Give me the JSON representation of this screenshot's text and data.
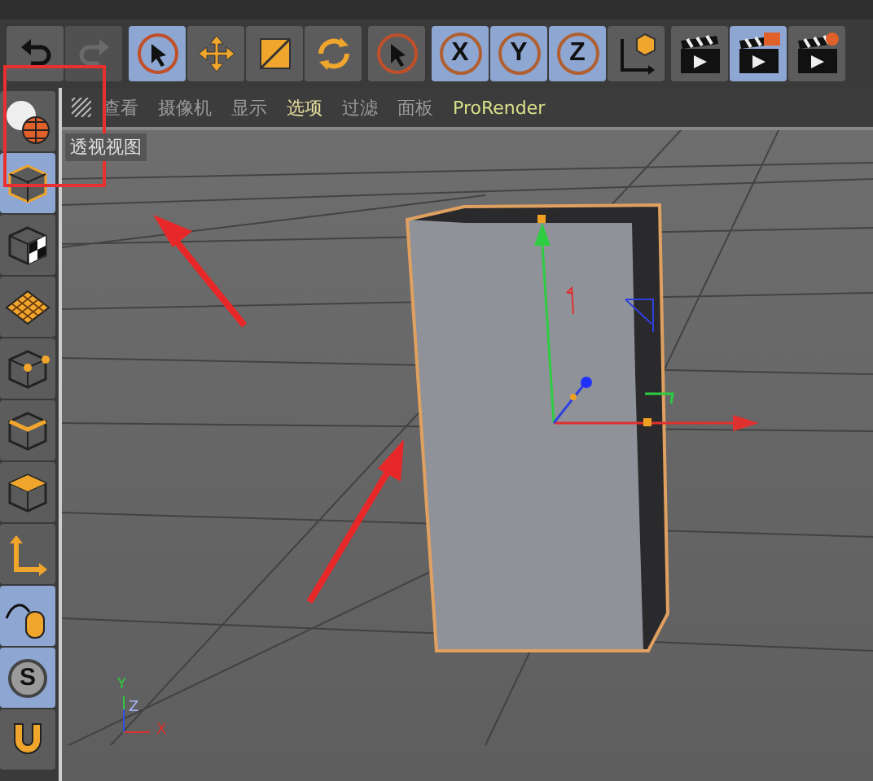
{
  "toolbar": [
    {
      "kind": "undo",
      "selected": false,
      "disabled": false
    },
    {
      "kind": "redo",
      "selected": false,
      "disabled": true
    },
    {
      "kind": "select",
      "selected": true,
      "disabled": false
    },
    {
      "kind": "move",
      "selected": false,
      "disabled": false
    },
    {
      "kind": "scale",
      "selected": false,
      "disabled": false
    },
    {
      "kind": "rotate",
      "selected": false,
      "disabled": false
    },
    {
      "kind": "select",
      "selected": false,
      "disabled": false
    },
    {
      "kind": "axis",
      "label": "X",
      "selected": true,
      "disabled": false
    },
    {
      "kind": "axis",
      "label": "Y",
      "selected": true,
      "disabled": false
    },
    {
      "kind": "axis",
      "label": "Z",
      "selected": true,
      "disabled": false
    },
    {
      "kind": "coords",
      "selected": false,
      "disabled": false
    },
    {
      "kind": "render",
      "selected": false,
      "disabled": false
    },
    {
      "kind": "render-settings",
      "selected": true,
      "disabled": false
    },
    {
      "kind": "render-gear",
      "selected": false,
      "disabled": false
    }
  ],
  "side_tools": [
    {
      "kind": "globe",
      "selected": false
    },
    {
      "kind": "cube",
      "selected": true
    },
    {
      "kind": "texture",
      "selected": false
    },
    {
      "kind": "plane",
      "selected": false
    },
    {
      "kind": "points",
      "selected": false
    },
    {
      "kind": "edges",
      "selected": false
    },
    {
      "kind": "polygons",
      "selected": false
    },
    {
      "kind": "axis",
      "selected": false
    },
    {
      "kind": "mouse",
      "selected": true
    },
    {
      "kind": "snap",
      "label": "S",
      "selected": true
    },
    {
      "kind": "magnet",
      "selected": false
    }
  ],
  "viewport": {
    "menu": [
      {
        "label": "查看",
        "color": "#9a9a9a"
      },
      {
        "label": "摄像机",
        "color": "#9a9a9a"
      },
      {
        "label": "显示",
        "color": "#9a9a9a"
      },
      {
        "label": "选项",
        "color": "#e8e0a0"
      },
      {
        "label": "过滤",
        "color": "#9a9a9a"
      },
      {
        "label": "面板",
        "color": "#9a9a9a"
      },
      {
        "label": "ProRender",
        "color": "#d8e08a"
      }
    ],
    "view_label": "透视视图",
    "axis_labels": {
      "y": "Y",
      "z": "Z",
      "x": "X"
    }
  }
}
